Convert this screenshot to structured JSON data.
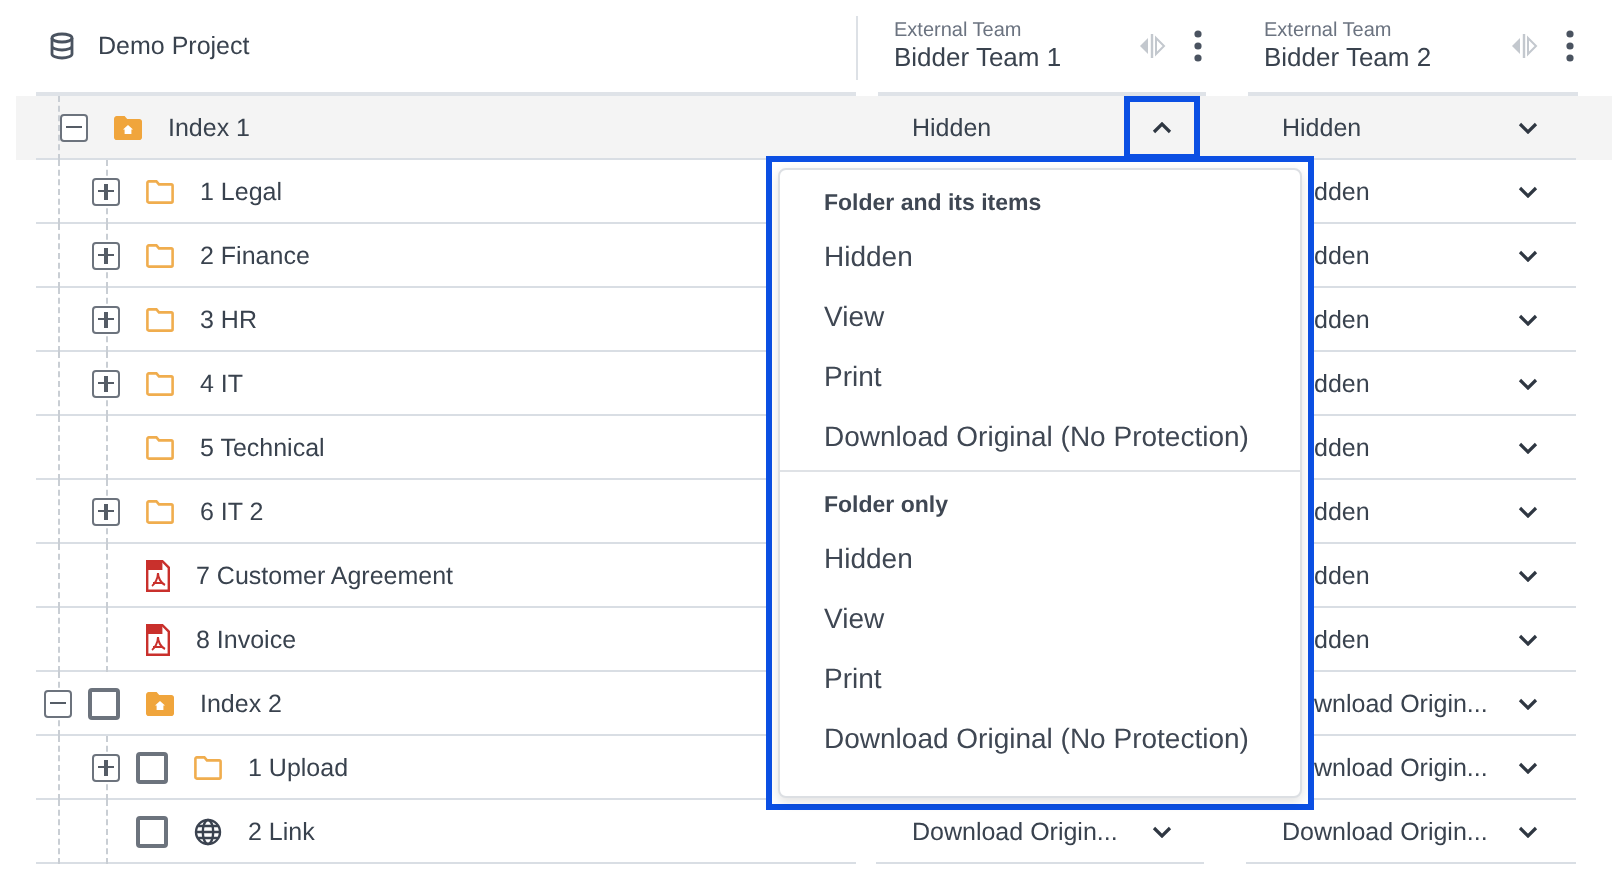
{
  "project": {
    "name": "Demo Project"
  },
  "columns": [
    {
      "group": "External Team",
      "name": "Bidder Team 1"
    },
    {
      "group": "External Team",
      "name": "Bidder Team 2"
    }
  ],
  "tree": [
    {
      "label": "Index 1",
      "kind": "index",
      "expanded": true,
      "selected": true,
      "team_1": {
        "value": "Hidden",
        "open": true,
        "covered": false
      },
      "team_2": {
        "value": "Hidden",
        "open": false,
        "covered": false
      },
      "children": [
        {
          "label": "1 Legal",
          "kind": "folder",
          "expanded": false,
          "selected": false,
          "team_2": {
            "value": "dden",
            "open": false,
            "covered": true
          }
        },
        {
          "label": "2 Finance",
          "kind": "folder",
          "expanded": false,
          "selected": false,
          "team_2": {
            "value": "dden",
            "open": false,
            "covered": true
          }
        },
        {
          "label": "3 HR",
          "kind": "folder",
          "expanded": false,
          "selected": false,
          "team_2": {
            "value": "dden",
            "open": false,
            "covered": true
          }
        },
        {
          "label": "4 IT",
          "kind": "folder",
          "expanded": false,
          "selected": false,
          "team_2": {
            "value": "dden",
            "open": false,
            "covered": true
          }
        },
        {
          "label": "5 Technical",
          "kind": "folder",
          "selected": false,
          "team_2": {
            "value": "dden",
            "open": false,
            "covered": true
          }
        },
        {
          "label": "6 IT 2",
          "kind": "folder",
          "expanded": false,
          "selected": false,
          "team_2": {
            "value": "dden",
            "open": false,
            "covered": true
          }
        },
        {
          "label": "7 Customer Agreement",
          "kind": "pdf",
          "selected": false,
          "team_2": {
            "value": "dden",
            "open": false,
            "covered": true
          }
        },
        {
          "label": "8 Invoice",
          "kind": "pdf",
          "selected": false,
          "team_2": {
            "value": "dden",
            "open": false,
            "covered": true
          }
        }
      ]
    },
    {
      "label": "Index 2",
      "kind": "index",
      "expanded": true,
      "selected": false,
      "checked": false,
      "team_2": {
        "value": "wnload Origin...",
        "open": false,
        "covered": true
      },
      "children": [
        {
          "label": "1 Upload",
          "kind": "folder",
          "expanded": false,
          "selected": false,
          "checked": false,
          "team_2": {
            "value": "wnload Origin...",
            "open": false,
            "covered": true
          }
        },
        {
          "label": "2 Link",
          "kind": "link",
          "selected": false,
          "checked": false,
          "team_1": {
            "value": "Download Origin...",
            "open": false,
            "covered": false
          },
          "team_2": {
            "value": "Download Origin...",
            "open": false,
            "covered": false
          }
        }
      ]
    }
  ],
  "dropdown": {
    "sections": [
      {
        "title": "Folder and its items",
        "options": [
          "Hidden",
          "View",
          "Print",
          "Download Original (No Protection)"
        ]
      },
      {
        "title": "Folder only",
        "options": [
          "Hidden",
          "View",
          "Print",
          "Download Original (No Protection)"
        ]
      }
    ]
  }
}
